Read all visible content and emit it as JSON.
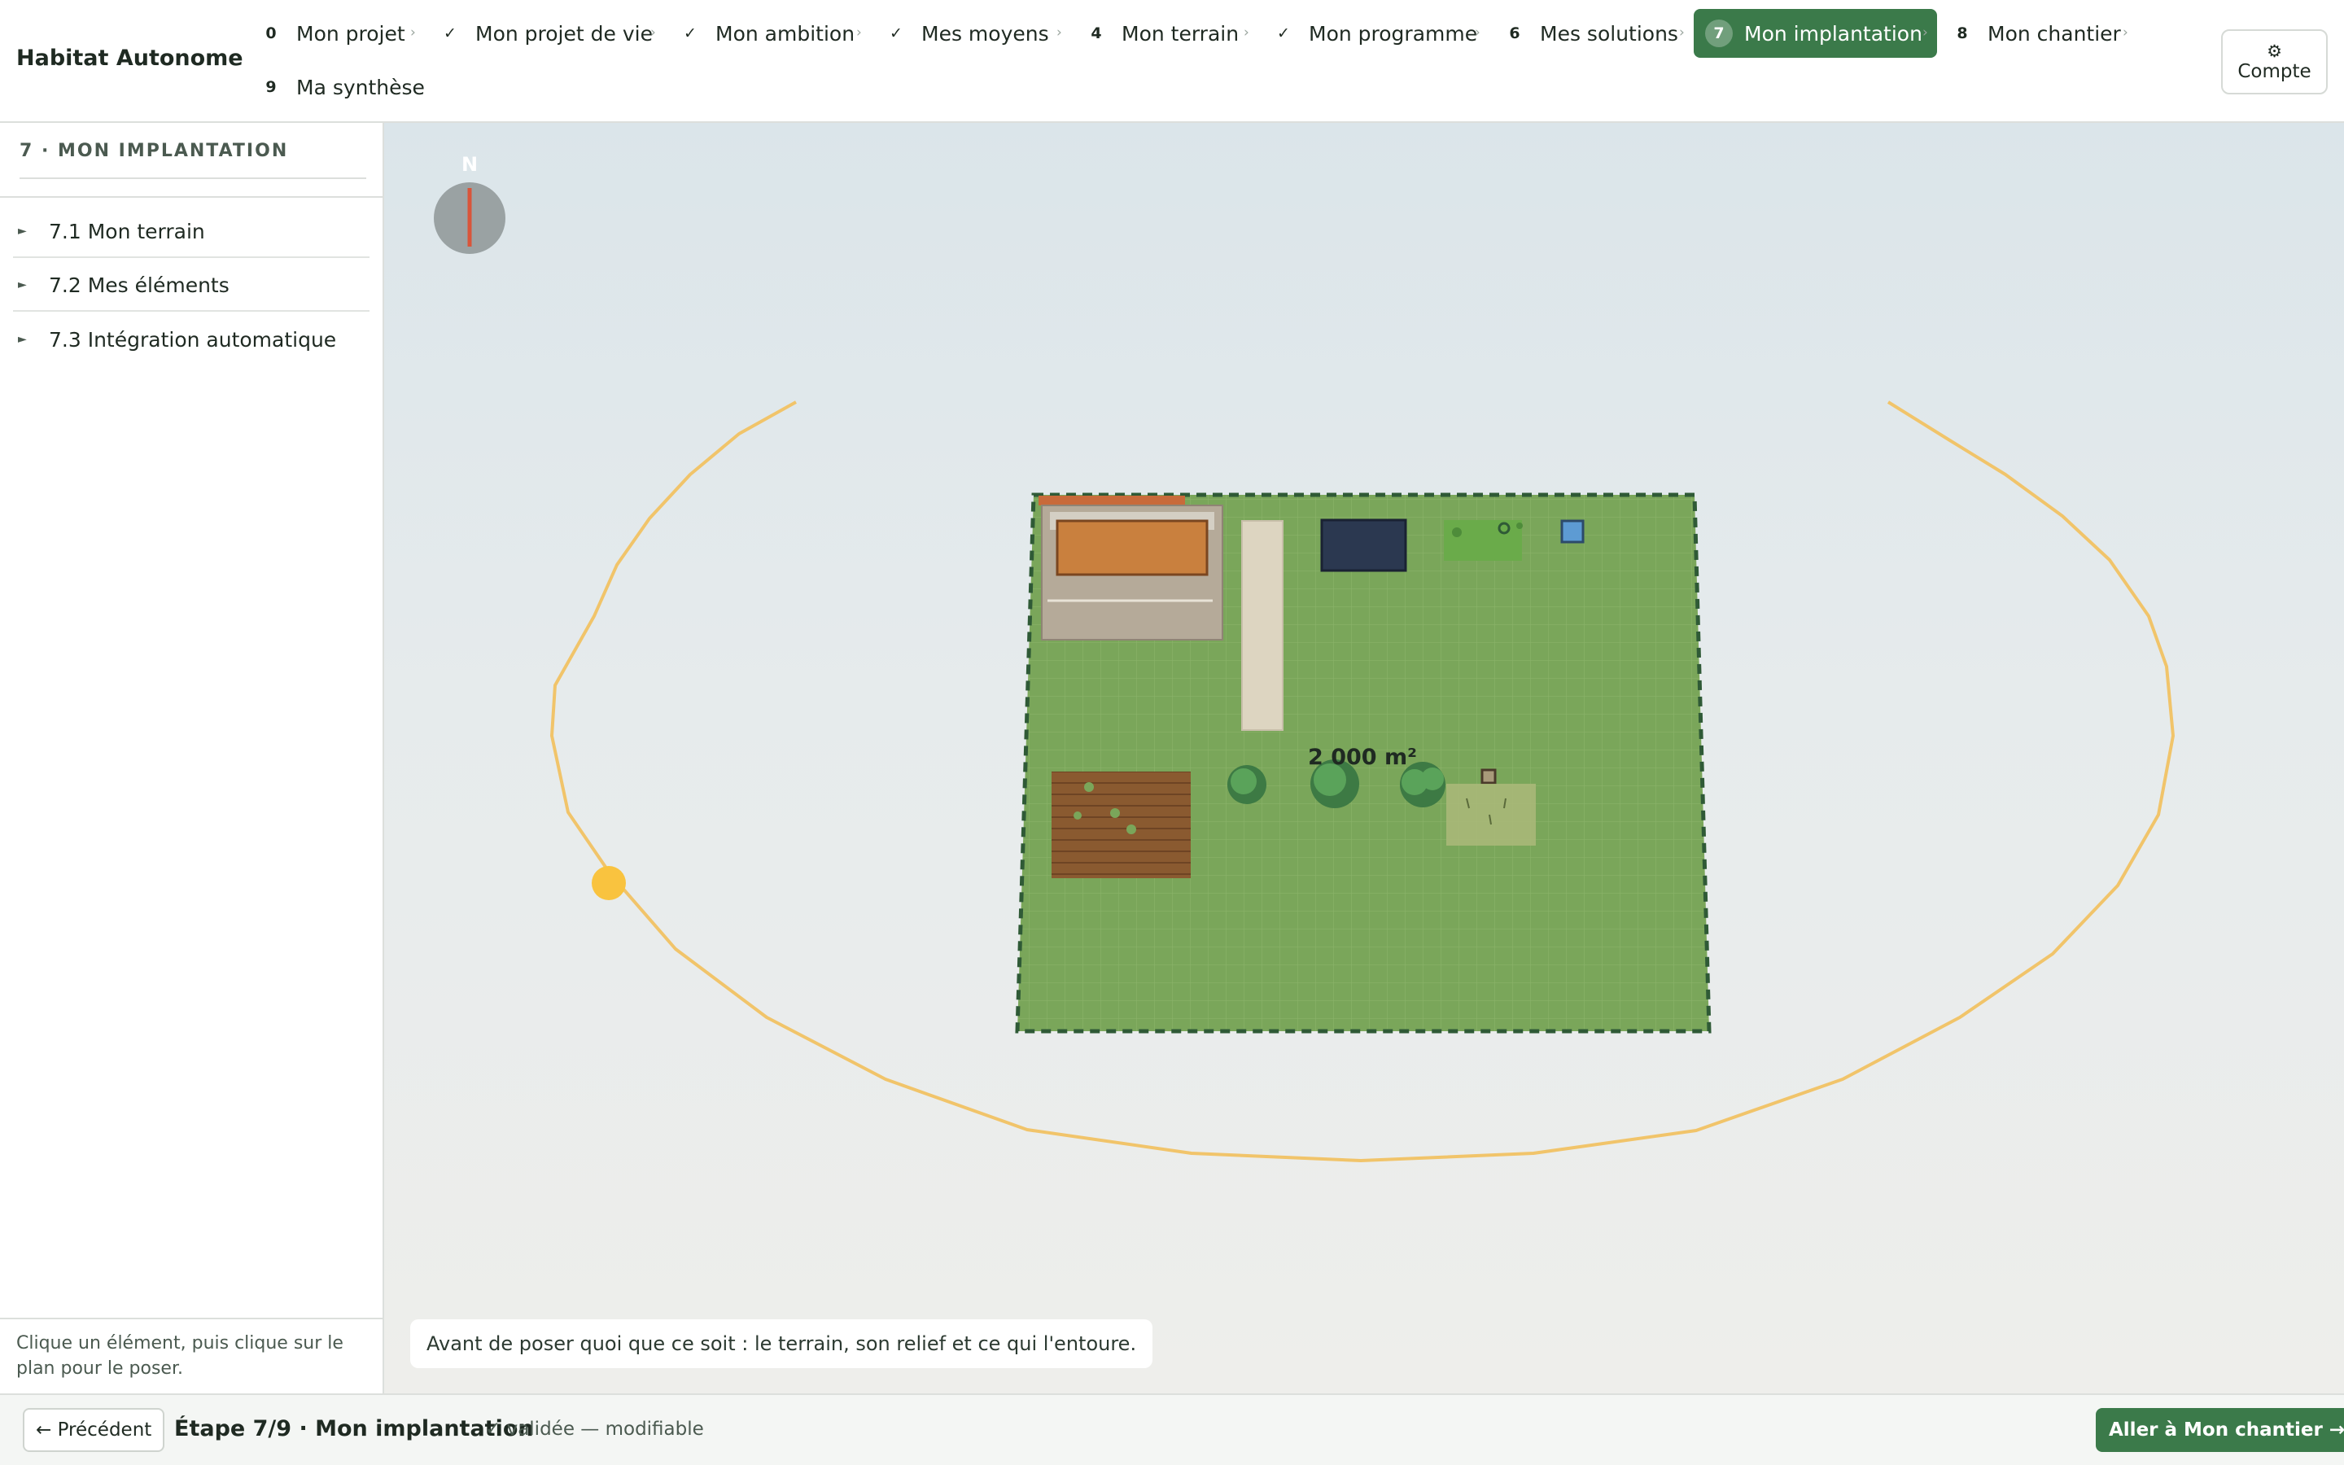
{
  "app": {
    "title": "Habitat Autonome"
  },
  "steps": [
    {
      "num": "0",
      "label": "Mon projet",
      "state": "todo"
    },
    {
      "num": "✓",
      "label": "Mon projet de vie",
      "state": "done"
    },
    {
      "num": "✓",
      "label": "Mon ambition",
      "state": "done"
    },
    {
      "num": "✓",
      "label": "Mes moyens",
      "state": "done"
    },
    {
      "num": "4",
      "label": "Mon terrain",
      "state": "todo"
    },
    {
      "num": "✓",
      "label": "Mon programme",
      "state": "done"
    },
    {
      "num": "6",
      "label": "Mes solutions",
      "state": "todo"
    },
    {
      "num": "7",
      "label": "Mon implantation",
      "state": "current"
    },
    {
      "num": "8",
      "label": "Mon chantier",
      "state": "todo"
    },
    {
      "num": "9",
      "label": "Ma synthèse",
      "state": "todo"
    }
  ],
  "step_separator": "›",
  "account": {
    "icon": "gear-icon",
    "glyph": "⚙",
    "label": "Compte"
  },
  "sidebar": {
    "title": "7 · MON IMPLANTATION",
    "items": [
      {
        "label": "7.1 Mon terrain",
        "icon": "triangle-right-icon",
        "glyph": "►"
      },
      {
        "label": "7.2 Mes éléments",
        "icon": "triangle-right-icon",
        "glyph": "►"
      },
      {
        "label": "7.3 Intégration automatique",
        "icon": "triangle-right-icon",
        "glyph": "►"
      }
    ],
    "hint": "Clique un élément, puis clique sur le plan pour le poser."
  },
  "canvas": {
    "compass_label": "N",
    "area_label": "2 000 m²",
    "info": "Avant de poser quoi que ce soit : le terrain, son relief et ce qui l'entoure."
  },
  "footer": {
    "prev_label": "← Précédent",
    "step_label": "Étape 7/9 · Mon implantation",
    "status": "✓ validée — modifiable",
    "next_label": "Aller à Mon chantier →"
  },
  "colors": {
    "accent": "#3b7a4a",
    "plot_fill": "#7aa65a",
    "plot_border": "#2f5a36",
    "sun": "#f9c33f",
    "sun_path": "#f1c46a",
    "compass_needle": "#d9553a"
  }
}
